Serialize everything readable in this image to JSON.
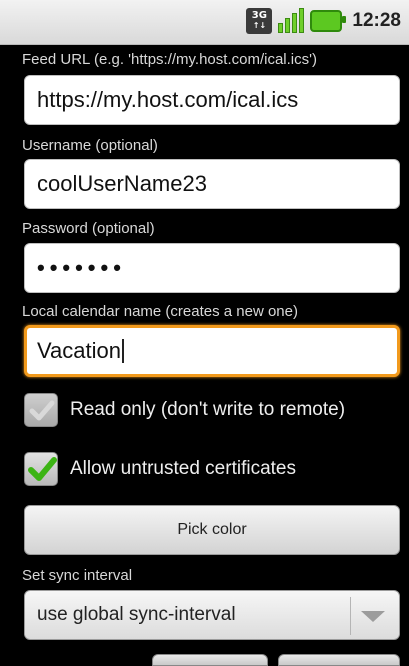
{
  "status_bar": {
    "network_icon": "3g-icon",
    "network_text_top": "3G",
    "network_text_bottom": "↑↓",
    "signal_icon": "signal-icon",
    "battery_icon": "battery-icon",
    "time": "12:28"
  },
  "form": {
    "feed_url": {
      "label": "Feed URL (e.g. 'https://my.host.com/ical.ics')",
      "value": "https://my.host.com/ical.ics"
    },
    "username": {
      "label": "Username (optional)",
      "value": "coolUserName23"
    },
    "password": {
      "label": "Password (optional)",
      "value": "•••••••"
    },
    "calendar_name": {
      "label": "Local calendar name (creates a new one)",
      "value": "Vacation"
    },
    "read_only": {
      "label": "Read only (don't write to remote)",
      "checked": false
    },
    "untrusted": {
      "label": "Allow untrusted certificates",
      "checked": true
    },
    "pick_color_label": "Pick color",
    "sync": {
      "label": "Set sync interval",
      "value": "use global sync-interval"
    }
  },
  "colors": {
    "focus_border": "#f29a1c",
    "check_green": "#3cb414",
    "background": "#000000"
  }
}
